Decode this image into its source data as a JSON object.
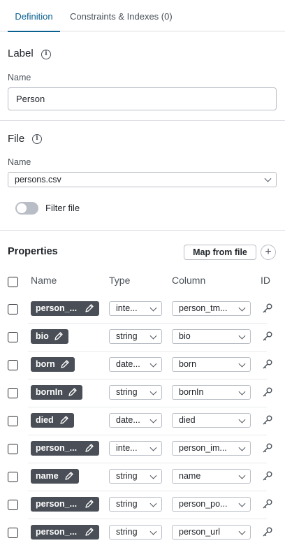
{
  "tabs": [
    {
      "label": "Definition",
      "active": true
    },
    {
      "label": "Constraints & Indexes (0)",
      "active": false
    }
  ],
  "label_section": {
    "title": "Label",
    "name_label": "Name",
    "name_value": "Person"
  },
  "file_section": {
    "title": "File",
    "name_label": "Name",
    "file_value": "persons.csv",
    "filter_label": "Filter file",
    "filter_on": false
  },
  "properties": {
    "title": "Properties",
    "map_button": "Map from file",
    "add_button": "+",
    "columns": {
      "name": "Name",
      "type": "Type",
      "column": "Column",
      "id": "ID"
    },
    "rows": [
      {
        "name": "person_...",
        "type": "inte...",
        "column": "person_tm..."
      },
      {
        "name": "bio",
        "type": "string",
        "column": "bio"
      },
      {
        "name": "born",
        "type": "date...",
        "column": "born"
      },
      {
        "name": "bornIn",
        "type": "string",
        "column": "bornIn"
      },
      {
        "name": "died",
        "type": "date...",
        "column": "died"
      },
      {
        "name": "person_...",
        "type": "inte...",
        "column": "person_im..."
      },
      {
        "name": "name",
        "type": "string",
        "column": "name"
      },
      {
        "name": "person_...",
        "type": "string",
        "column": "person_po..."
      },
      {
        "name": "person_...",
        "type": "string",
        "column": "person_url"
      }
    ]
  },
  "colors": {
    "accent": "#0a6190",
    "pill": "#4a4f57",
    "border": "#b9bec6"
  }
}
